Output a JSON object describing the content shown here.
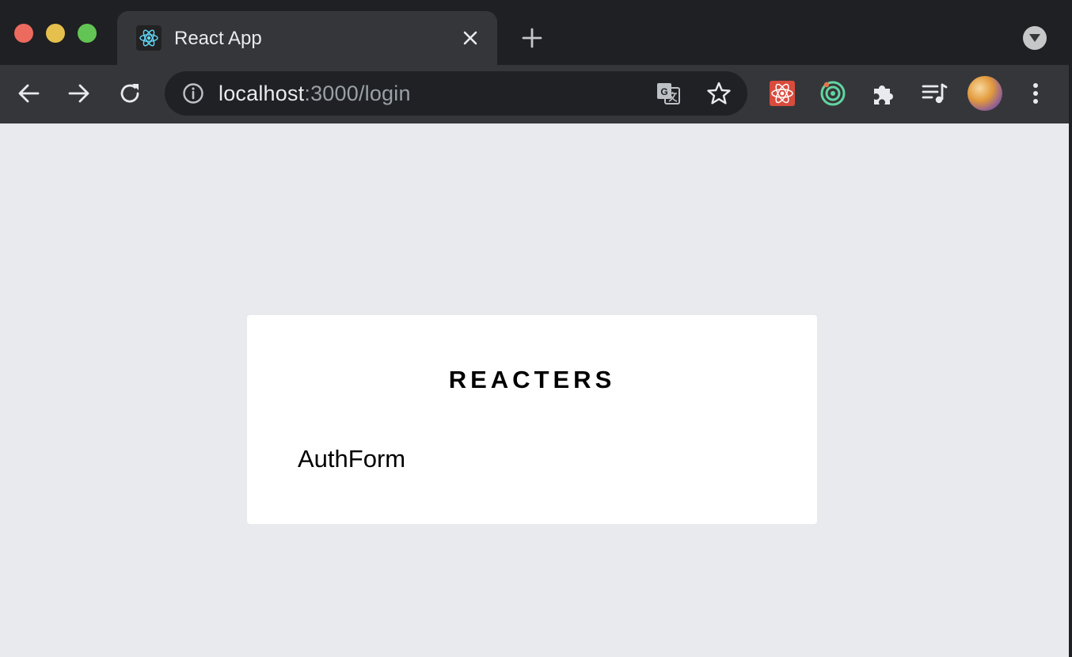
{
  "browser": {
    "tab": {
      "title": "React App",
      "favicon": "react-atom-icon"
    },
    "address_bar": {
      "host": "localhost",
      "path": ":3000/login"
    },
    "icons": {
      "back": "arrow-left-icon",
      "forward": "arrow-right-icon",
      "reload": "reload-icon",
      "site_info": "info-icon",
      "translate": "translate-icon",
      "bookmark": "star-icon",
      "extensions": [
        "react-devtools-icon",
        "target-ring-icon",
        "puzzle-icon",
        "media-queue-icon"
      ],
      "menu": "more-vert-icon"
    },
    "colors": {
      "tabstrip": "#1f2023",
      "toolbar": "#35363a",
      "omnibox": "#202124",
      "close": "#ed6a5e",
      "minimize": "#e6c04c",
      "maximize": "#62c454"
    }
  },
  "page": {
    "brand": "REACTERS",
    "content": "AuthForm",
    "background": "#e9eaed"
  }
}
